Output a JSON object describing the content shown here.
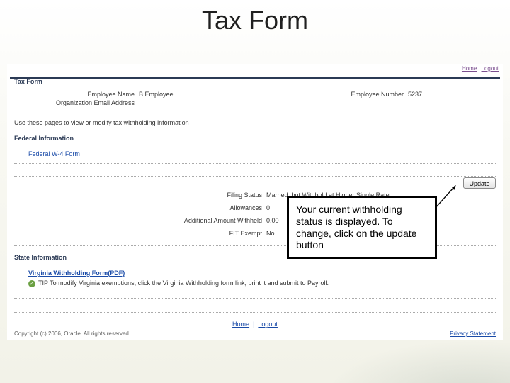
{
  "slide_title": "Tax Form",
  "mini_links": [
    "Home",
    "Logout"
  ],
  "section_main": "Tax Form",
  "employee": {
    "name_label": "Employee Name",
    "name_value": "B Employee",
    "num_label": "Employee Number",
    "num_value": "5237",
    "org_email_label": "Organization Email Address",
    "org_email_value": ""
  },
  "instruction": "Use these pages to view or modify tax withholding information",
  "federal": {
    "heading": "Federal Information",
    "form_link": "Federal W-4 Form",
    "rows": {
      "filing_status_label": "Filing Status",
      "filing_status_value": "Married, but Withhold at Higher Single Rate",
      "allowances_label": "Allowances",
      "allowances_value": "0",
      "additional_label": "Additional Amount Withheld",
      "additional_value": "0.00",
      "fit_exempt_label": "FIT Exempt",
      "fit_exempt_value": "No"
    }
  },
  "update_button": "Update",
  "state": {
    "heading": "State Information",
    "form_link": "Virginia Withholding Form(PDF)",
    "tip": "TIP To modify Virginia exemptions, click the Virginia Withholding form link, print it and submit to Payroll."
  },
  "footer": {
    "home": "Home",
    "logout": "Logout",
    "copyright": "Copyright (c) 2006, Oracle. All rights reserved.",
    "privacy": "Privacy Statement"
  },
  "callout_text": "Your current withholding status is displayed. To change, click on the update button"
}
